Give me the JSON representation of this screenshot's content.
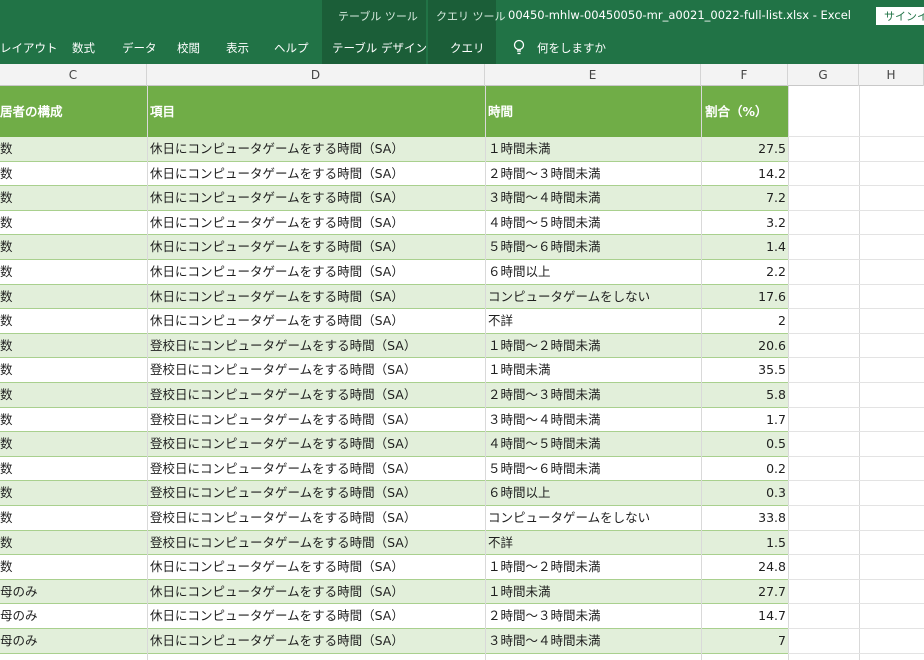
{
  "titlebar": {
    "context_table_label": "テーブル ツール",
    "context_query_label": "クエリ ツール",
    "document_title": "00450-mhlw-00450050-mr_a0021_0022-full-list.xlsx  -  Excel",
    "signin_label": "サインイ"
  },
  "ribbon": {
    "tabs": [
      "レイアウト",
      "数式",
      "データ",
      "校閲",
      "表示",
      "ヘルプ",
      "テーブル デザイン",
      "クエリ"
    ],
    "tell_me": "何をしますか"
  },
  "columns": [
    "C",
    "D",
    "E",
    "F",
    "G",
    "H"
  ],
  "table": {
    "headers": [
      "居者の構成",
      "項目",
      "時間",
      "割合（%）"
    ],
    "rows": [
      [
        "数",
        "休日にコンピュータゲームをする時間（SA）",
        "１時間未満",
        "27.5"
      ],
      [
        "数",
        "休日にコンピュータゲームをする時間（SA）",
        "２時間～３時間未満",
        "14.2"
      ],
      [
        "数",
        "休日にコンピュータゲームをする時間（SA）",
        "３時間～４時間未満",
        "7.2"
      ],
      [
        "数",
        "休日にコンピュータゲームをする時間（SA）",
        "４時間～５時間未満",
        "3.2"
      ],
      [
        "数",
        "休日にコンピュータゲームをする時間（SA）",
        "５時間～６時間未満",
        "1.4"
      ],
      [
        "数",
        "休日にコンピュータゲームをする時間（SA）",
        "６時間以上",
        "2.2"
      ],
      [
        "数",
        "休日にコンピュータゲームをする時間（SA）",
        "コンピュータゲームをしない",
        "17.6"
      ],
      [
        "数",
        "休日にコンピュータゲームをする時間（SA）",
        "不詳",
        "2"
      ],
      [
        "数",
        "登校日にコンピュータゲームをする時間（SA）",
        "１時間～２時間未満",
        "20.6"
      ],
      [
        "数",
        "登校日にコンピュータゲームをする時間（SA）",
        "１時間未満",
        "35.5"
      ],
      [
        "数",
        "登校日にコンピュータゲームをする時間（SA）",
        "２時間～３時間未満",
        "5.8"
      ],
      [
        "数",
        "登校日にコンピュータゲームをする時間（SA）",
        "３時間～４時間未満",
        "1.7"
      ],
      [
        "数",
        "登校日にコンピュータゲームをする時間（SA）",
        "４時間～５時間未満",
        "0.5"
      ],
      [
        "数",
        "登校日にコンピュータゲームをする時間（SA）",
        "５時間～６時間未満",
        "0.2"
      ],
      [
        "数",
        "登校日にコンピュータゲームをする時間（SA）",
        "６時間以上",
        "0.3"
      ],
      [
        "数",
        "登校日にコンピュータゲームをする時間（SA）",
        "コンピュータゲームをしない",
        "33.8"
      ],
      [
        "数",
        "登校日にコンピュータゲームをする時間（SA）",
        "不詳",
        "1.5"
      ],
      [
        "数",
        "休日にコンピュータゲームをする時間（SA）",
        "１時間～２時間未満",
        "24.8"
      ],
      [
        "母のみ",
        "休日にコンピュータゲームをする時間（SA）",
        "１時間未満",
        "27.7"
      ],
      [
        "母のみ",
        "休日にコンピュータゲームをする時間（SA）",
        "２時間～３時間未満",
        "14.7"
      ],
      [
        "母のみ",
        "休日にコンピュータゲームをする時間（SA）",
        "３時間～４時間未満",
        "7"
      ]
    ]
  },
  "colors": {
    "excel_green": "#217346",
    "header_green": "#70ad47",
    "band_green": "#e2efda"
  }
}
